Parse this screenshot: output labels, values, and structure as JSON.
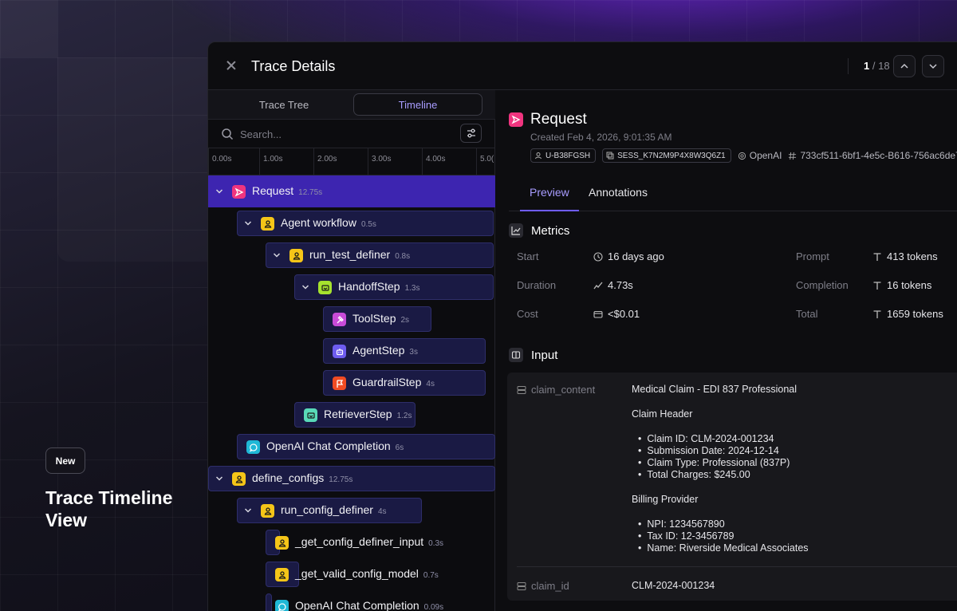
{
  "hero": {
    "badge": "New",
    "title": "Trace Timeline View"
  },
  "panel": {
    "title": "Trace Details",
    "pager": {
      "current": "1",
      "total": "/ 18"
    }
  },
  "left": {
    "tabs": [
      "Trace Tree",
      "Timeline"
    ],
    "search_placeholder": "Search...",
    "ticks": [
      "0.00s",
      "1.00s",
      "2.00s",
      "3.00s",
      "4.00s",
      "5.0("
    ],
    "tree": [
      {
        "label": "Request",
        "dur": "12.75s",
        "icon": "send-icon",
        "color": "#f0347f",
        "depth": 0,
        "chev": true,
        "selected": true
      },
      {
        "label": "Agent workflow",
        "dur": "0.5s",
        "icon": "user-icon",
        "color": "#f5c518",
        "depth": 1,
        "chev": true
      },
      {
        "label": "run_test_definer",
        "dur": "0.8s",
        "icon": "user-icon",
        "color": "#f5c518",
        "depth": 2,
        "chev": true
      },
      {
        "label": "HandoffStep",
        "dur": "1.3s",
        "icon": "handoff-icon",
        "color": "#a6e22e",
        "depth": 3,
        "chev": true
      },
      {
        "label": "ToolStep",
        "dur": "2s",
        "icon": "hammer-icon",
        "color": "#c84bd8",
        "depth": 4
      },
      {
        "label": "AgentStep",
        "dur": "3s",
        "icon": "robot-icon",
        "color": "#6e5cf0",
        "depth": 4
      },
      {
        "label": "GuardrailStep",
        "dur": "4s",
        "icon": "flag-icon",
        "color": "#f04b23",
        "depth": 4
      },
      {
        "label": "RetrieverStep",
        "dur": "1.2s",
        "icon": "retriever-icon",
        "color": "#59d9b8",
        "depth": 3
      },
      {
        "label": "OpenAI Chat Completion",
        "dur": "6s",
        "icon": "chat-icon",
        "color": "#1fb8d6",
        "depth": 1
      },
      {
        "label": "define_configs",
        "dur": "12.75s",
        "icon": "user-icon",
        "color": "#f5c518",
        "depth": 0,
        "chev": true
      },
      {
        "label": "run_config_definer",
        "dur": "4s",
        "icon": "user-icon",
        "color": "#f5c518",
        "depth": 1,
        "chev": true
      },
      {
        "label": "_get_config_definer_input",
        "dur": "0.3s",
        "icon": "user-icon",
        "color": "#f5c518",
        "depth": 2
      },
      {
        "label": "_get_valid_config_model",
        "dur": "0.7s",
        "icon": "user-icon",
        "color": "#f5c518",
        "depth": 2
      },
      {
        "label": "OpenAI Chat Completion",
        "dur": "0.09s",
        "icon": "chat-icon",
        "color": "#1fb8d6",
        "depth": 2
      }
    ]
  },
  "right": {
    "title": "Request",
    "created": "Created Feb 4, 2026, 9:01:35 AM",
    "chips": {
      "user": "U-B38FGSH",
      "session": "SESS_K7N2M9P4X8W3Q6Z1",
      "provider": "OpenAI",
      "hash": "733cf511-6bf1-4e5c-B616-756ac6de7"
    },
    "tabs": [
      "Preview",
      "Annotations"
    ],
    "metrics": {
      "title": "Metrics",
      "start_label": "Start",
      "start_value": "16 days ago",
      "duration_label": "Duration",
      "duration_value": "4.73s",
      "cost_label": "Cost",
      "cost_value": "<$0.01",
      "prompt_label": "Prompt",
      "prompt_value": "413 tokens",
      "completion_label": "Completion",
      "completion_value": "16 tokens",
      "total_label": "Total",
      "total_value": "1659 tokens"
    },
    "input": {
      "title": "Input",
      "claim_content_key": "claim_content",
      "claim_content": {
        "line1": "Medical Claim - EDI 837 Professional",
        "header_title": "Claim Header",
        "header_items": [
          "Claim ID: CLM-2024-001234",
          "Submission Date: 2024-12-14",
          "Claim Type: Professional (837P)",
          "Total Charges: $245.00"
        ],
        "billing_title": "Billing Provider",
        "billing_items": [
          "NPI: 1234567890",
          "Tax ID: 12-3456789",
          "Name: Riverside Medical Associates"
        ]
      },
      "claim_id_key": "claim_id",
      "claim_id": "CLM-2024-001234"
    }
  }
}
